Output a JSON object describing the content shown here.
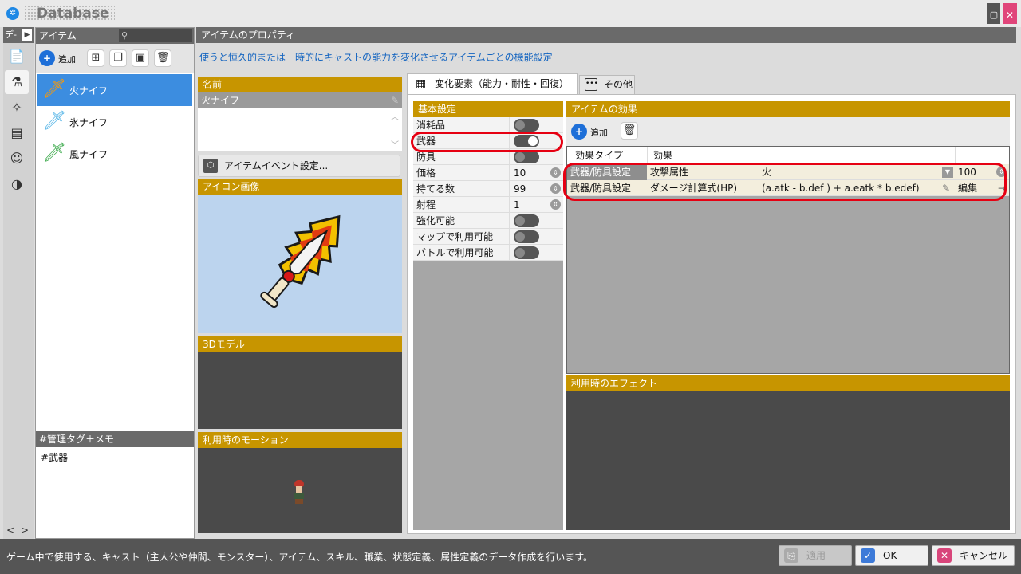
{
  "window": {
    "title": "Database"
  },
  "sidebar": {
    "header": "デ-",
    "header_arrow": "▶",
    "tabs": [
      "document-icon",
      "potion-icon",
      "skill-icon",
      "class-icon",
      "state-icon",
      "element-icon"
    ],
    "nav_prev": "<",
    "nav_next": ">"
  },
  "item_list": {
    "header": "アイテム",
    "search_placeholder": "",
    "add_label": "追加",
    "items": [
      {
        "name": "火ナイフ"
      },
      {
        "name": "氷ナイフ"
      },
      {
        "name": "風ナイフ"
      }
    ],
    "memo_header": "#管理タグ＋メモ",
    "memo_text": "#武器"
  },
  "properties": {
    "header": "アイテムのプロパティ",
    "description": "使うと恒久的または一時的にキャストの能力を変化させるアイテムごとの機能設定"
  },
  "name_section": {
    "header": "名前",
    "value": "火ナイフ",
    "event_button": "アイテムイベント設定...",
    "icon_header": "アイコン画像",
    "model_header": "3Dモデル",
    "motion_header": "利用時のモーション"
  },
  "tabs": {
    "active": "変化要素（能力・耐性・回復）",
    "other": "その他"
  },
  "basic": {
    "header": "基本設定",
    "rows": [
      {
        "label": "消耗品",
        "type": "toggle",
        "on": false
      },
      {
        "label": "武器",
        "type": "toggle",
        "on": true
      },
      {
        "label": "防具",
        "type": "toggle",
        "on": false
      },
      {
        "label": "価格",
        "type": "number",
        "value": "10"
      },
      {
        "label": "持てる数",
        "type": "number",
        "value": "99"
      },
      {
        "label": "射程",
        "type": "number",
        "value": "1"
      },
      {
        "label": "強化可能",
        "type": "toggle",
        "on": false
      },
      {
        "label": "マップで利用可能",
        "type": "toggle",
        "on": false
      },
      {
        "label": "バトルで利用可能",
        "type": "toggle",
        "on": false
      }
    ]
  },
  "effects": {
    "header": "アイテムの効果",
    "add_label": "追加",
    "columns": [
      "効果タイプ",
      "効果"
    ],
    "rows": [
      {
        "type": "武器/防具設定",
        "effect": "攻撃属性",
        "param": "火",
        "value": "100"
      },
      {
        "type": "武器/防具設定",
        "effect": "ダメージ計算式(HP)",
        "param": "(a.atk - b.def ) + a.eatk * b.edef)",
        "value": "編集"
      }
    ],
    "fx_header": "利用時のエフェクト"
  },
  "status": {
    "text": "ゲーム中で使用する、キャスト（主人公や仲間、モンスター）、アイテム、スキル、職業、状態定義、属性定義のデータ作成を行います。"
  },
  "buttons": {
    "apply": "適用",
    "ok": "OK",
    "cancel": "キャンセル"
  },
  "colors": {
    "accent": "#c79500",
    "selection": "#3c8de0",
    "highlight": "#e60012"
  }
}
